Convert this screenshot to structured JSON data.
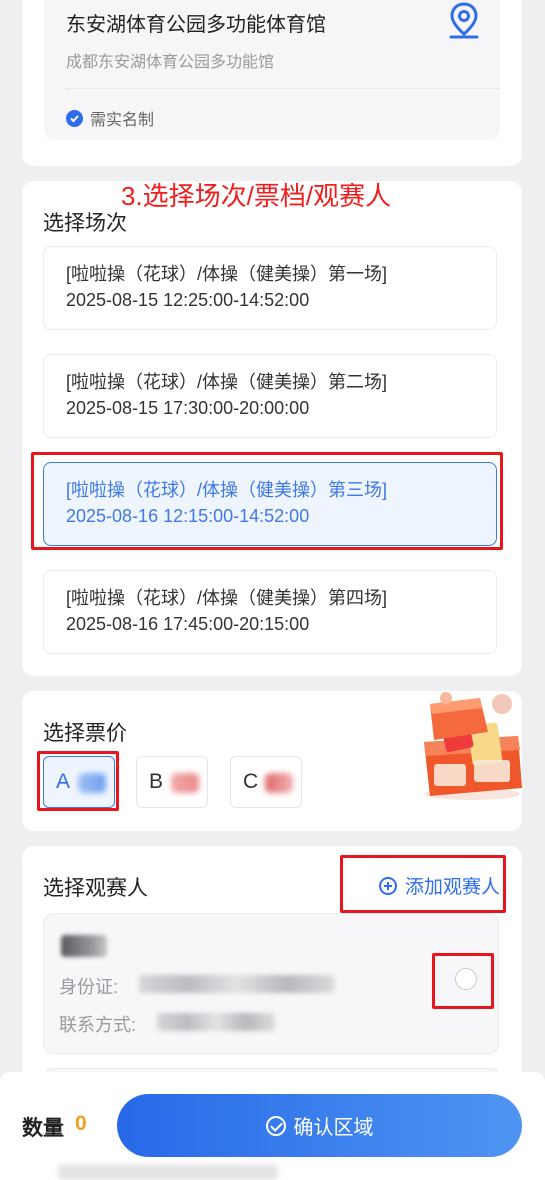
{
  "venue": {
    "name": "东安湖体育公园多功能体育馆",
    "subname": "成都东安湖体育公园多功能馆",
    "real_name_note": "需实名制"
  },
  "annotation_text": "3.选择场次/票档/观赛人",
  "sessions": {
    "title": "选择场次",
    "items": [
      {
        "name": "[啦啦操（花球）/体操（健美操）第一场]",
        "time": "2025-08-15 12:25:00-14:52:00",
        "selected": false
      },
      {
        "name": "[啦啦操（花球）/体操（健美操）第二场]",
        "time": "2025-08-15 17:30:00-20:00:00",
        "selected": false
      },
      {
        "name": "[啦啦操（花球）/体操（健美操）第三场]",
        "time": "2025-08-16 12:15:00-14:52:00",
        "selected": true
      },
      {
        "name": "[啦啦操（花球）/体操（健美操）第四场]",
        "time": "2025-08-16 17:45:00-20:15:00",
        "selected": false
      }
    ]
  },
  "prices": {
    "title": "选择票价",
    "items": [
      {
        "label": "A",
        "selected": true
      },
      {
        "label": "B",
        "selected": false
      },
      {
        "label": "C",
        "selected": false
      }
    ]
  },
  "viewers": {
    "title": "选择观赛人",
    "add_label": "添加观赛人",
    "id_label": "身份证:",
    "contact_label": "联系方式:"
  },
  "footer": {
    "quantity_label": "数量",
    "quantity_value": "0",
    "confirm_label": "确认区域"
  },
  "colors": {
    "accent": "#2f6dee",
    "highlight_box": "#e8141e",
    "quantity": "#f29d1d"
  }
}
